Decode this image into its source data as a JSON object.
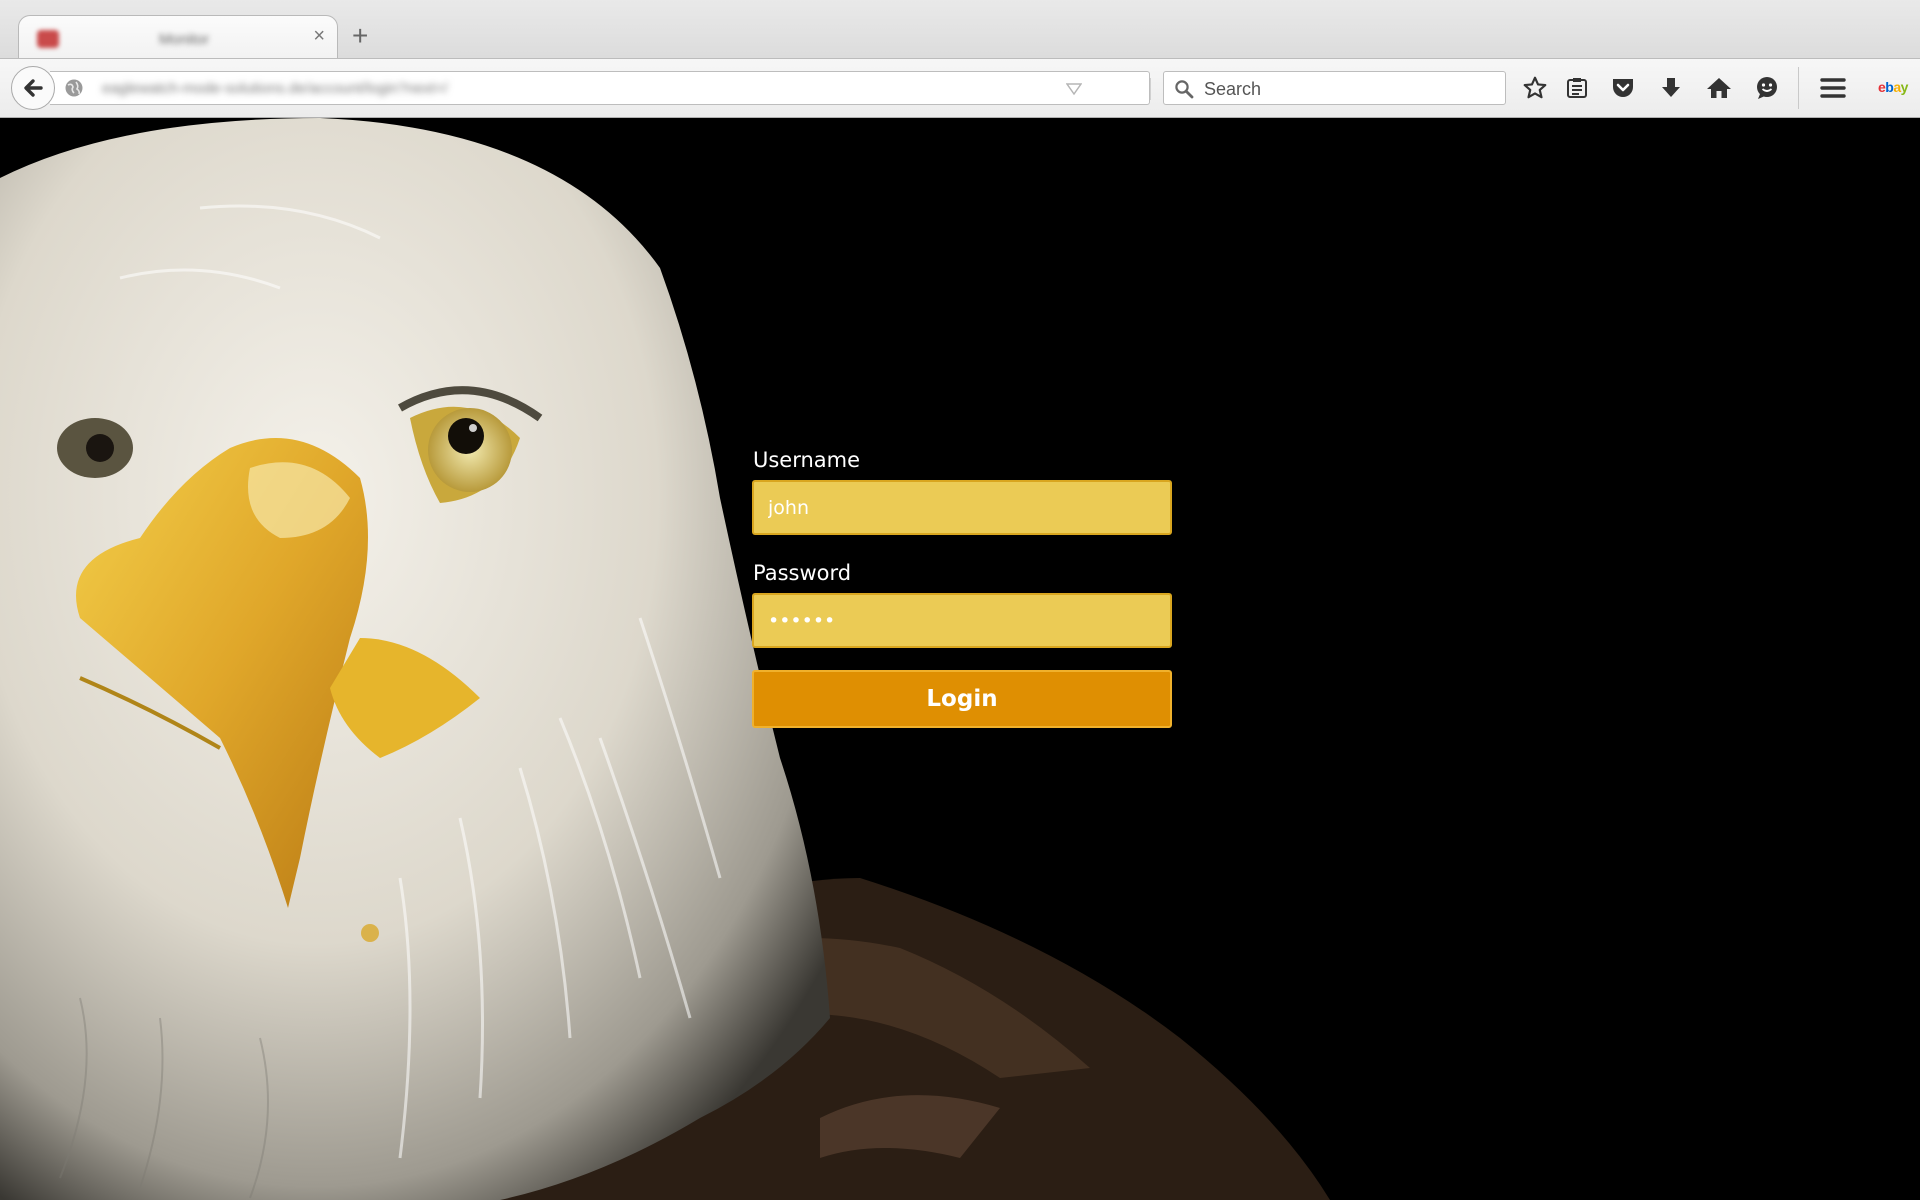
{
  "browser": {
    "tab": {
      "title": "Monitor",
      "close_glyph": "×"
    },
    "new_tab_glyph": "+",
    "address_bar": {
      "url": "eaglewatch-mode-solutions.de/account/login?next=/"
    },
    "search": {
      "placeholder": "Search"
    },
    "toolbar_icons": [
      "bookmark-star-icon",
      "reading-list-icon",
      "pocket-icon",
      "download-icon",
      "home-icon",
      "hello-chat-icon",
      "hamburger-menu-icon"
    ],
    "ebay_logo": {
      "letters": [
        "e",
        "b",
        "a",
        "y"
      ],
      "colors": [
        "#e53238",
        "#0064d2",
        "#f5af02",
        "#86b817"
      ]
    }
  },
  "login": {
    "username_label": "Username",
    "username_value": "john",
    "password_label": "Password",
    "password_value": "••••••",
    "submit_label": "Login"
  },
  "colors": {
    "input_bg": "#ebcb55",
    "input_border": "#d9a61f",
    "button_bg": "#df8f02",
    "page_bg": "#000000"
  }
}
